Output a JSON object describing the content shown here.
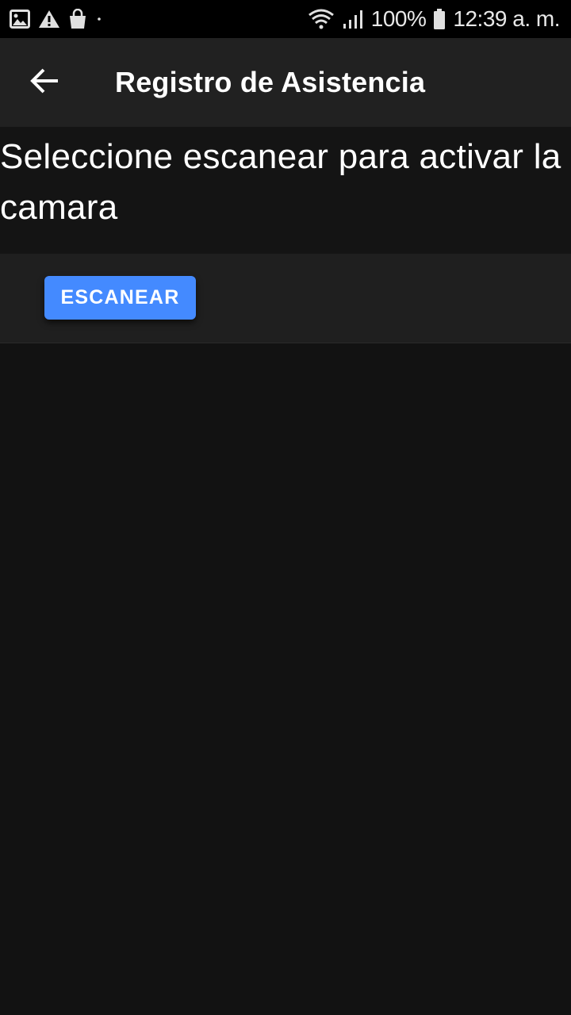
{
  "status_bar": {
    "battery": "100%",
    "time": "12:39 a. m.",
    "left_icons": [
      "image-icon",
      "warning-icon",
      "shopping-bag-icon",
      "dot-icon"
    ],
    "right_icons": [
      "wifi-icon",
      "signal-icon",
      "battery-icon"
    ]
  },
  "app_bar": {
    "back_icon": "arrow-back-icon",
    "title": "Registro de Asistencia"
  },
  "main": {
    "instruction": "Seleccione escanear para activar la camara",
    "scan_button_label": "ESCANEAR"
  },
  "colors": {
    "background": "#121212",
    "app_bar": "#212121",
    "status_bar": "#000000",
    "accent": "#448aff",
    "text": "#ffffff"
  }
}
